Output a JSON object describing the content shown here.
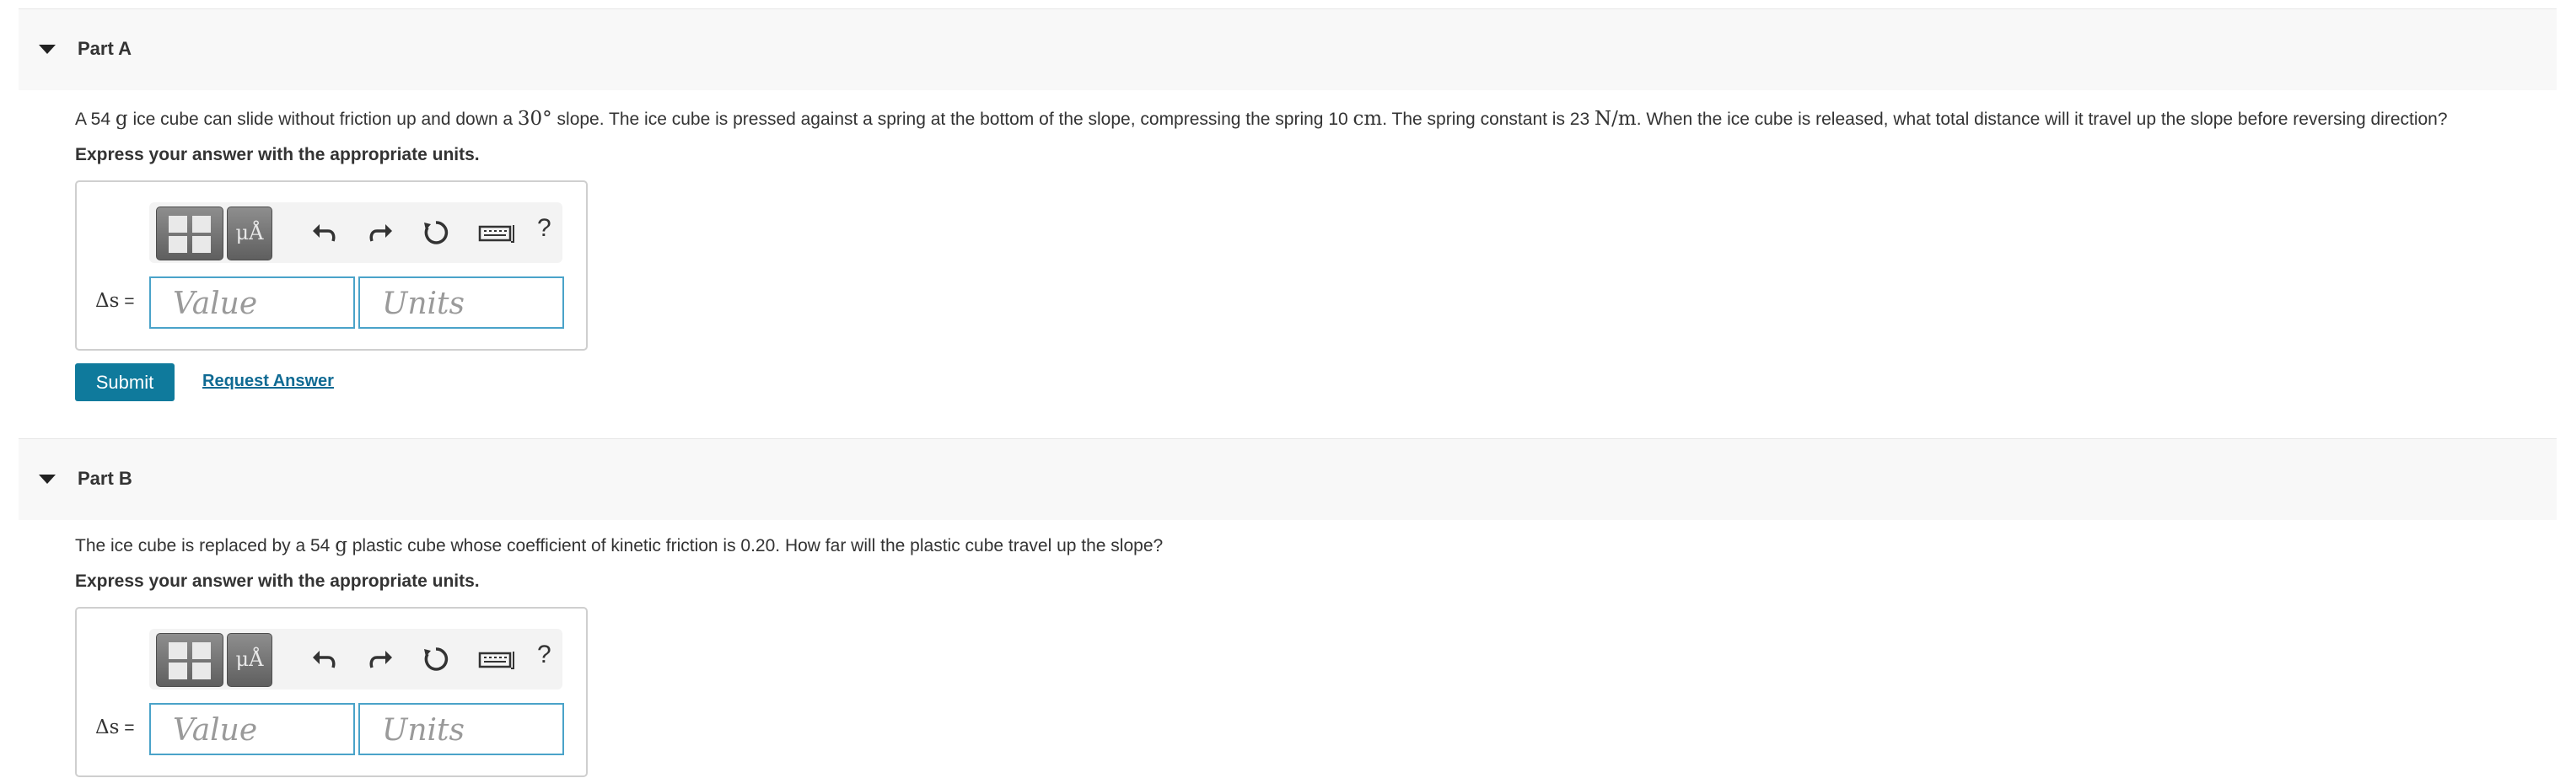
{
  "partA": {
    "title": "Part A",
    "question": {
      "t1": "A 54 ",
      "m1": "g",
      "t2": " ice cube can slide without friction up and down a ",
      "m2": "30°",
      "t3": " slope. The ice cube is pressed against a spring at the bottom of the slope, compressing the spring 10 ",
      "m3": "cm",
      "t4": ". The spring constant is 23 ",
      "m4": "N/m",
      "t5": ". When the ice cube is released, what total distance will it travel up the slope before reversing direction?"
    },
    "instruction": "Express your answer with the appropriate units.",
    "answer": {
      "label_var": "Δs",
      "label_eq": " =",
      "value_placeholder": "Value",
      "units_placeholder": "Units",
      "units_button": "μÅ",
      "help": "?"
    },
    "submit_label": "Submit",
    "request_label": "Request Answer"
  },
  "partB": {
    "title": "Part B",
    "question": {
      "t1": "The ice cube is replaced by a 54 ",
      "m1": "g",
      "t2": " plastic cube whose coefficient of kinetic friction is 0.20. How far will the plastic cube travel up the slope?"
    },
    "instruction": "Express your answer with the appropriate units.",
    "answer": {
      "label_var": "Δs",
      "label_eq": " =",
      "value_placeholder": "Value",
      "units_placeholder": "Units",
      "units_button": "μÅ",
      "help": "?"
    }
  },
  "colors": {
    "accent": "#0f7a9c",
    "link": "#0f6a93",
    "field_border": "#4aa3c9",
    "header_bg": "#f8f8f8"
  },
  "icons": [
    "caret-down-icon",
    "templates-icon",
    "units-icon",
    "undo-icon",
    "redo-icon",
    "reset-icon",
    "keyboard-icon",
    "help-icon"
  ]
}
